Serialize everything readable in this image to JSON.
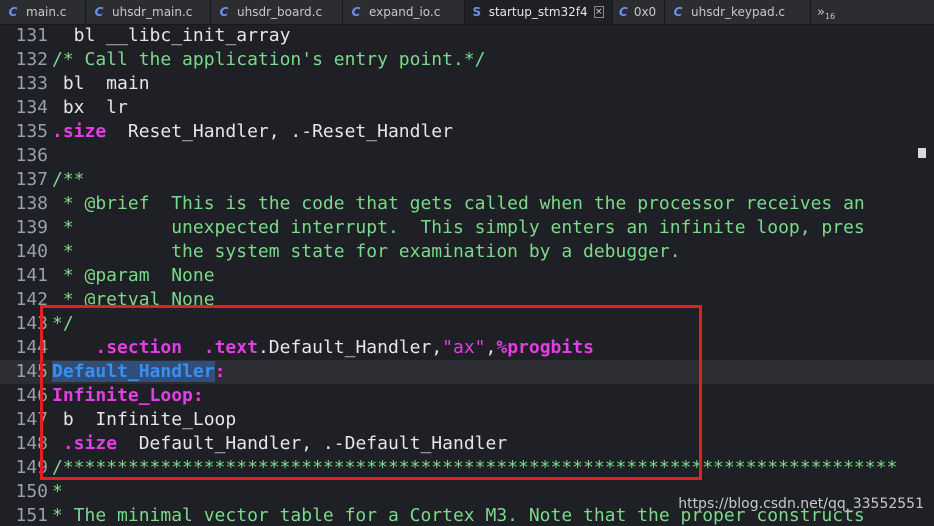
{
  "tabs": [
    {
      "label": "main.c",
      "icon": "c-file-icon",
      "icon_glyph": "C",
      "active": false
    },
    {
      "label": "uhsdr_main.c",
      "icon": "c-file-icon",
      "icon_glyph": "C",
      "active": false
    },
    {
      "label": "uhsdr_board.c",
      "icon": "c-file-icon",
      "icon_glyph": "C",
      "active": false
    },
    {
      "label": "expand_io.c",
      "icon": "c-file-icon",
      "icon_glyph": "C",
      "active": false
    },
    {
      "label": "startup_stm32f4",
      "icon": "asm-file-icon",
      "icon_glyph": "S",
      "active": true,
      "close": "×"
    },
    {
      "label": "0x0",
      "icon": "c-file-icon",
      "icon_glyph": "C",
      "active": false
    },
    {
      "label": "uhsdr_keypad.c",
      "icon": "c-file-icon",
      "icon_glyph": "C",
      "active": false
    }
  ],
  "tab_overflow": {
    "glyph": "»",
    "count": "16"
  },
  "lines": [
    {
      "n": "131",
      "parts": [
        {
          "t": "  bl __libc_init_array",
          "c": ""
        }
      ]
    },
    {
      "n": "132",
      "parts": [
        {
          "t": "/* Call the application's entry point.*/",
          "c": "cm"
        }
      ]
    },
    {
      "n": "133",
      "parts": [
        {
          "t": " bl  main",
          "c": ""
        }
      ]
    },
    {
      "n": "134",
      "parts": [
        {
          "t": " bx  lr",
          "c": ""
        }
      ]
    },
    {
      "n": "135",
      "parts": [
        {
          "t": ".size",
          "c": "kw"
        },
        {
          "t": "  Reset_Handler, .-Reset_Handler",
          "c": ""
        }
      ]
    },
    {
      "n": "136",
      "parts": []
    },
    {
      "n": "137",
      "parts": [
        {
          "t": "/**",
          "c": "cm"
        }
      ]
    },
    {
      "n": "138",
      "parts": [
        {
          "t": " * @brief  This is the code that gets called when the processor receives an",
          "c": "cm"
        }
      ]
    },
    {
      "n": "139",
      "parts": [
        {
          "t": " *         unexpected interrupt.  This simply enters an infinite loop, pres",
          "c": "cm"
        }
      ]
    },
    {
      "n": "140",
      "parts": [
        {
          "t": " *         the system state for examination by a debugger.",
          "c": "cm"
        }
      ]
    },
    {
      "n": "141",
      "parts": [
        {
          "t": " * @param  None",
          "c": "cm"
        }
      ]
    },
    {
      "n": "142",
      "parts": [
        {
          "t": " * @retval None",
          "c": "cm"
        }
      ]
    },
    {
      "n": "143",
      "parts": [
        {
          "t": "*/",
          "c": "cm"
        }
      ]
    },
    {
      "n": "144",
      "parts": [
        {
          "t": "    ",
          "c": ""
        },
        {
          "t": ".section",
          "c": "kw"
        },
        {
          "t": "  ",
          "c": ""
        },
        {
          "t": ".text",
          "c": "kw"
        },
        {
          "t": ".Default_Handler,",
          "c": ""
        },
        {
          "t": "\"ax\"",
          "c": "str"
        },
        {
          "t": ",",
          "c": ""
        },
        {
          "t": "%progbits",
          "c": "kw"
        }
      ]
    },
    {
      "n": "145",
      "current": true,
      "parts": [
        {
          "t": "Default_Handler",
          "c": "sel"
        },
        {
          "t": ":",
          "c": "lbl"
        }
      ]
    },
    {
      "n": "146",
      "parts": [
        {
          "t": "Infinite_Loop:",
          "c": "lbl"
        }
      ]
    },
    {
      "n": "147",
      "parts": [
        {
          "t": " b  Infinite_Loop",
          "c": ""
        }
      ]
    },
    {
      "n": "148",
      "parts": [
        {
          "t": " ",
          "c": ""
        },
        {
          "t": ".size",
          "c": "kw"
        },
        {
          "t": "  Default_Handler, .-Default_Handler",
          "c": ""
        }
      ]
    },
    {
      "n": "149",
      "parts": [
        {
          "t": "/*****************************************************************************",
          "c": "cm"
        }
      ]
    },
    {
      "n": "150",
      "parts": [
        {
          "t": "*",
          "c": "cm"
        }
      ]
    },
    {
      "n": "151",
      "parts": [
        {
          "t": "* The minimal vector table for a Cortex M3. Note that the proper constructs",
          "c": "cm"
        }
      ]
    }
  ],
  "watermark": "https://blog.csdn.net/qq_33552551",
  "colors": {
    "comment": "#7bd98a",
    "keyword": "#e33ee3",
    "selection": "#3a8ff0",
    "highlight_box": "#e51f1f"
  }
}
